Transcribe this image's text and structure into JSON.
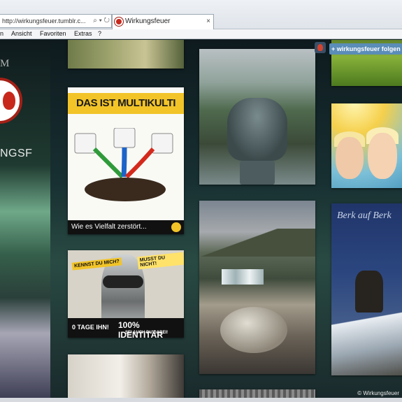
{
  "browser": {
    "address": "http://wirkungsfeuer.tumblr.c...",
    "address_controls": "⌕ ▾ ↻",
    "tab_title": "Wirkungsfeuer",
    "tab_close": "×"
  },
  "menu": {
    "items": [
      "n",
      "Ansicht",
      "Favoriten",
      "Extras",
      "?"
    ]
  },
  "sidebar": {
    "top_text": "M",
    "blog_name": "NGSF"
  },
  "follow_button": "+ wirkungsfeuer folgen",
  "posts": {
    "multikulti": {
      "banner": "DAS IST MULTIKULTI",
      "footer": "Wie es Vielfalt zerstört..."
    },
    "identitaer": {
      "tag1": "KENNST DU MICH?",
      "tag2": "MUSST DU NICHT!",
      "bottom_left": "0 TAGE IHN!",
      "bottom_right": "100% IDENTITÄR",
      "bottom_sub": "SEI AUCH DU DABEI!"
    },
    "ibex": {
      "script": "Berk auf Berk"
    }
  },
  "credit": "© Wirkungsfeuer"
}
